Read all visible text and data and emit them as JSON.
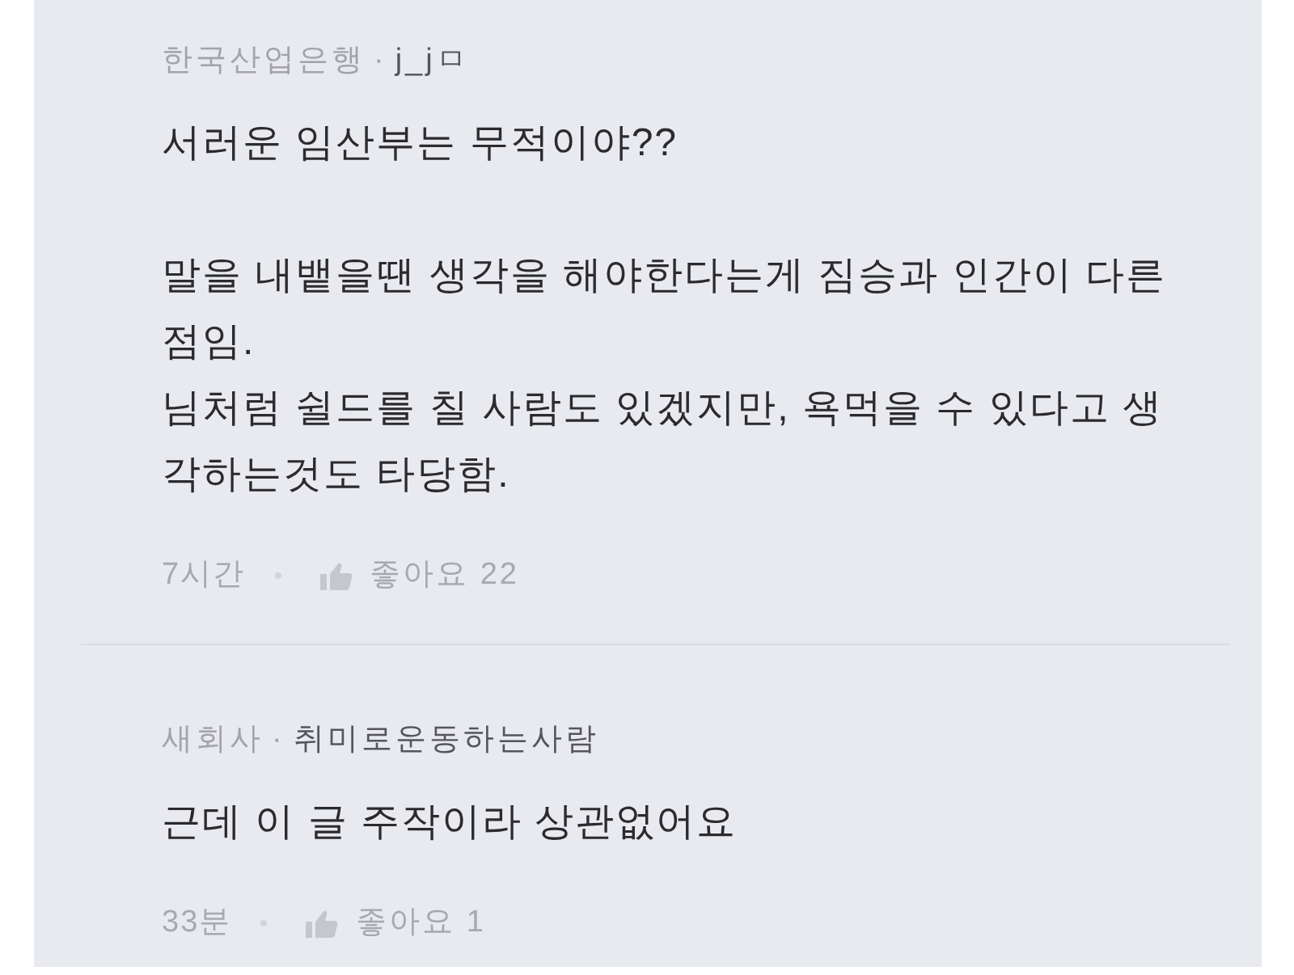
{
  "comments": [
    {
      "company": "한국산업은행",
      "author_separator": "·",
      "nickname": "j_jㅁ",
      "body": "서러운 임산부는 무적이야??\n\n말을 내뱉을땐 생각을 해야한다는게 짐승과 인간이 다른 점임.\n님처럼 쉴드를 칠 사람도 있겠지만, 욕먹을 수 있다고 생각하는것도 타당함.",
      "time": "7시간",
      "likes": "좋아요 22"
    },
    {
      "company": "새회사",
      "author_separator": "·",
      "nickname": "취미로운동하는사람",
      "body": "근데 이 글 주작이라 상관없어요",
      "time": "33분",
      "likes": "좋아요 1"
    }
  ]
}
